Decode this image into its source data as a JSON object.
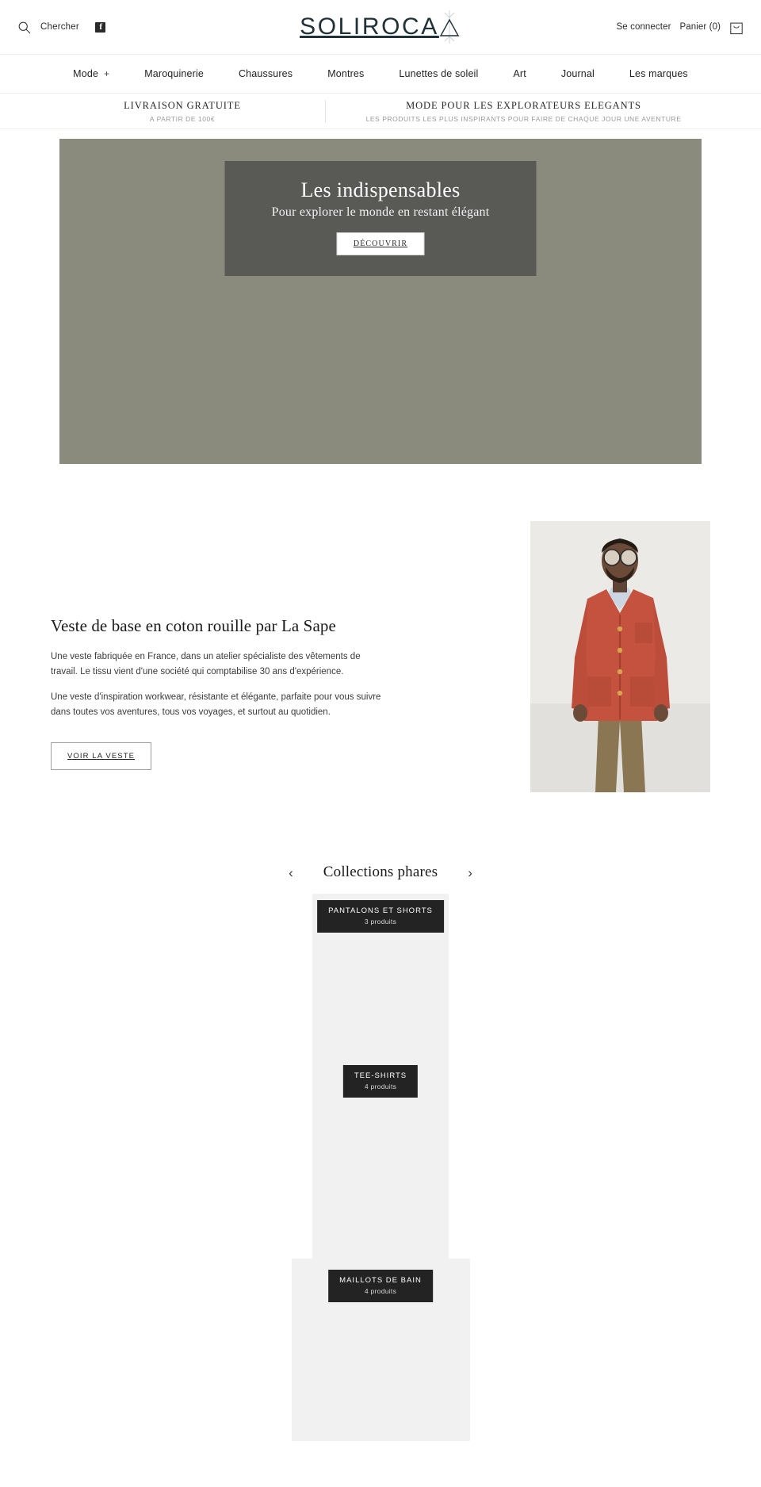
{
  "header": {
    "search_label": "Chercher",
    "search_icon": "search-icon",
    "facebook_icon": "facebook-icon",
    "logo_text": "SOLIROCA",
    "logo_mark": "triangle-compass-mark",
    "login_label": "Se connecter",
    "cart_label": "Panier (0)",
    "cart_icon": "shopping-bag-icon"
  },
  "nav": {
    "items": [
      {
        "label": "Mode",
        "has_plus": true,
        "plus": "+"
      },
      {
        "label": "Maroquinerie",
        "has_plus": false
      },
      {
        "label": "Chaussures",
        "has_plus": false
      },
      {
        "label": "Montres",
        "has_plus": false
      },
      {
        "label": "Lunettes de soleil",
        "has_plus": false
      },
      {
        "label": "Art",
        "has_plus": false
      },
      {
        "label": "Journal",
        "has_plus": false
      },
      {
        "label": "Les marques",
        "has_plus": false
      }
    ]
  },
  "announcement": {
    "left_title": "LIVRAISON GRATUITE",
    "left_sub": "A PARTIR DE 100€",
    "right_title": "MODE POUR LES EXPLORATEURS ELEGANTS",
    "right_sub": "LES PRODUITS LES PLUS INSPIRANTS POUR FAIRE DE CHAQUE JOUR UNE AVENTURE"
  },
  "hero": {
    "title": "Les indispensables",
    "subtitle": "Pour explorer le monde en restant élégant",
    "button_label": "DÉCOUVRIR",
    "background_color": "#8b8b7d",
    "overlay_color": "#4c4c4c"
  },
  "feature": {
    "title": "Veste de base en coton rouille par La Sape",
    "paragraph1": "Une veste fabriquée en France, dans un atelier spécialiste des vêtements de travail. Le tissu vient d'une société qui comptabilise 30 ans d'expérience.",
    "paragraph2": "Une veste d'inspiration workwear, résistante et élégante, parfaite pour vous suivre dans toutes vos aventures, tous vos voyages, et surtout au quotidien.",
    "button_label": "VOIR LA VESTE",
    "image_alt": "model-wearing-rust-cotton-jacket"
  },
  "collections": {
    "title": "Collections phares",
    "prev_icon": "chevron-left-icon",
    "prev_label": "‹",
    "next_icon": "chevron-right-icon",
    "next_label": "›",
    "cards": [
      {
        "name": "PANTALONS ET SHORTS",
        "count": "3 produits"
      },
      {
        "name": "TEE-SHIRTS",
        "count": "4 produits"
      },
      {
        "name": "MAILLOTS DE BAIN",
        "count": "4 produits"
      }
    ]
  }
}
